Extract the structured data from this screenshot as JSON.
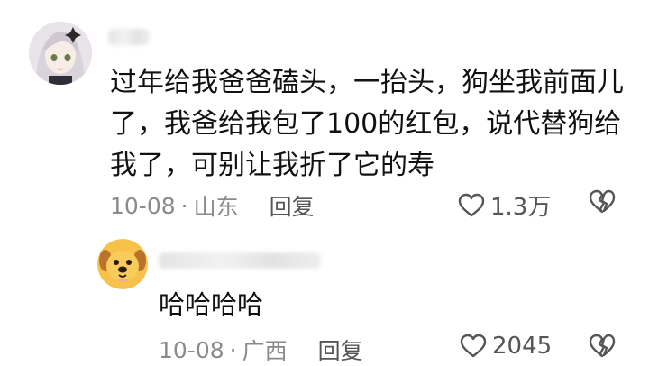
{
  "comment": {
    "text": "过年给我爸爸磕头，一抬头，狗坐我前面儿了，我爸给我包了100的红包，说代替狗给我了，可别让我折了它的寿",
    "date": "10-08",
    "location": "山东",
    "reply_label": "回复",
    "like_count": "1.3万"
  },
  "reply": {
    "text": "哈哈哈哈",
    "date": "10-08",
    "location": "广西",
    "reply_label": "回复",
    "like_count": "2045"
  },
  "icons": {
    "like": "heart-outline-icon",
    "dislike": "broken-heart-icon"
  },
  "colors": {
    "text": "#111111",
    "meta": "#8a8a8a"
  }
}
